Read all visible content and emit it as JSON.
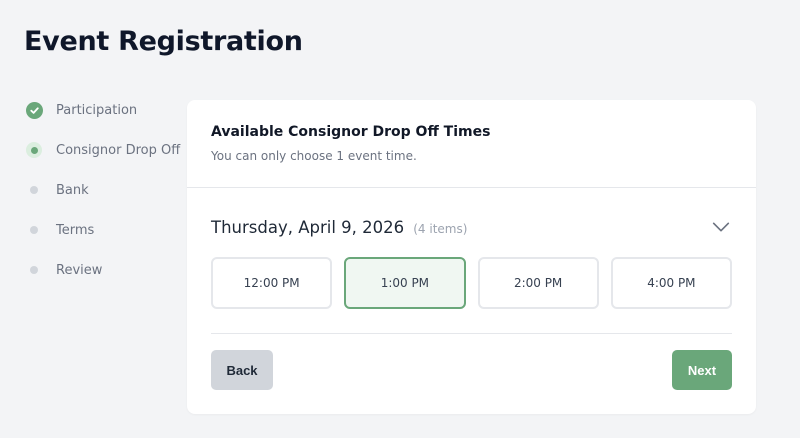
{
  "page": {
    "title": "Event Registration"
  },
  "steps": [
    {
      "label": "Participation",
      "status": "done"
    },
    {
      "label": "Consignor Drop Off",
      "status": "current"
    },
    {
      "label": "Bank",
      "status": "todo"
    },
    {
      "label": "Terms",
      "status": "todo"
    },
    {
      "label": "Review",
      "status": "todo"
    }
  ],
  "card": {
    "title": "Available Consignor Drop Off Times",
    "subtitle": "You can only choose 1 event time.",
    "date": "Thursday, April 9, 2026",
    "count": "(4 items)",
    "chevron_icon": "chevron-down-icon",
    "times": [
      {
        "label": "12:00 PM",
        "selected": false
      },
      {
        "label": "1:00 PM",
        "selected": true
      },
      {
        "label": "2:00 PM",
        "selected": false
      },
      {
        "label": "4:00 PM",
        "selected": false
      }
    ],
    "back_label": "Back",
    "next_label": "Next"
  },
  "colors": {
    "accent": "#6aa77a",
    "accent_light": "#dbeedf",
    "selected_bg": "#f0f7f2",
    "page_bg": "#f3f4f6"
  }
}
